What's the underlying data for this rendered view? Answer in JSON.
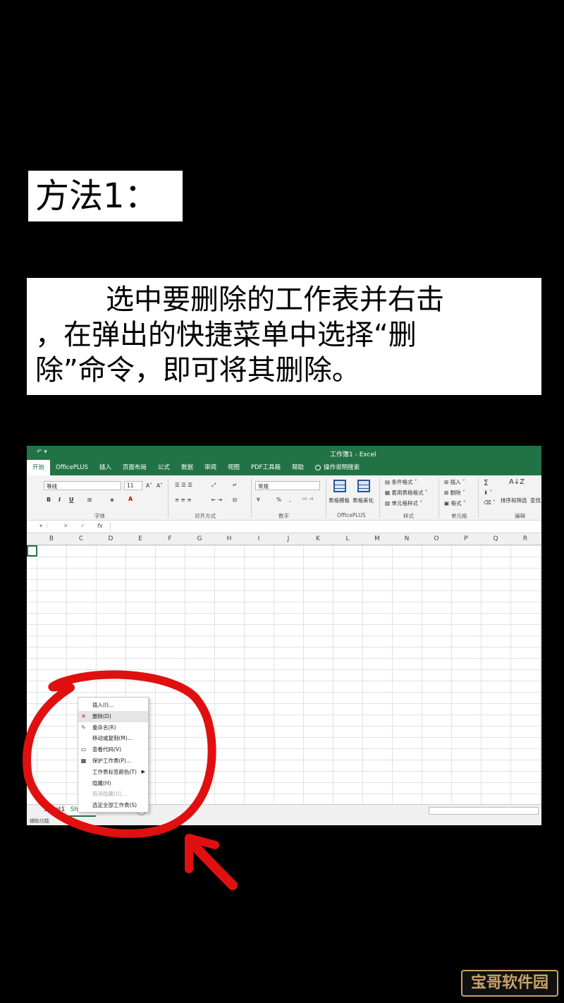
{
  "heading": "方法1：",
  "instruction": {
    "line1": "选中要删除的工作表并右击",
    "line2": "，在弹出的快捷菜单中选择“删",
    "line3": "除”命令，即可将其删除。"
  },
  "excel": {
    "window_title": "工作簿1 - Excel",
    "quick_access": "↶ ▾",
    "tabs": [
      "开始",
      "OfficePLUS",
      "插入",
      "页面布局",
      "公式",
      "数据",
      "审阅",
      "视图",
      "PDF工具箱",
      "帮助"
    ],
    "tell_me": "操作说明搜索",
    "ribbon": {
      "font_name": "等线",
      "font_size": "11",
      "grow_font": "A˄",
      "shrink_font": "A˅",
      "bold": "B",
      "italic": "I",
      "underline": "U",
      "font_color": "A",
      "group_font": "字体",
      "group_align": "对齐方式",
      "number_format": "常规",
      "percent": "%",
      "comma": ",",
      "group_number": "数字",
      "table_template": "表格模板",
      "table_beautify": "表格美化",
      "group_officeplus": "OfficePLUS",
      "conditional_format": "条件格式",
      "format_as_table": "套用表格格式",
      "cell_styles": "单元格样式",
      "group_styles": "样式",
      "insert": "插入",
      "delete": "删除",
      "format": "格式",
      "group_cells": "单元格",
      "sum_symbol": "Σ",
      "sort_filter": "排序和筛选",
      "find_select": "查找",
      "group_editing": "编辑"
    },
    "formula_fx": "fx",
    "columns": [
      "B",
      "C",
      "D",
      "E",
      "F",
      "G",
      "H",
      "I",
      "J",
      "K",
      "L",
      "M",
      "N",
      "O",
      "P",
      "Q",
      "R"
    ],
    "sheet_tabs": [
      "Sheet1",
      "Sheet2"
    ],
    "new_sheet": "+",
    "status": "辅助功能",
    "context_menu": [
      {
        "label": "插入(I)...",
        "icon": ""
      },
      {
        "label": "删除(D)",
        "icon": "delete-sheet-icon",
        "highlight": true
      },
      {
        "label": "重命名(R)",
        "icon": "rename-icon"
      },
      {
        "label": "移动或复制(M)...",
        "icon": ""
      },
      {
        "label": "查看代码(V)",
        "icon": "view-code-icon"
      },
      {
        "label": "保护工作表(P)...",
        "icon": "protect-sheet-icon"
      },
      {
        "label": "工作表标签颜色(T)",
        "icon": "",
        "submenu": true
      },
      {
        "label": "隐藏(H)",
        "icon": ""
      },
      {
        "label": "取消隐藏(U)...",
        "icon": "",
        "disabled": true
      },
      {
        "label": "选定全部工作表(S)",
        "icon": ""
      }
    ]
  },
  "watermark": "宝哥软件园",
  "colors": {
    "excel_green": "#217346",
    "annotation_red": "#e01010",
    "watermark_gold": "#c8a26a"
  }
}
